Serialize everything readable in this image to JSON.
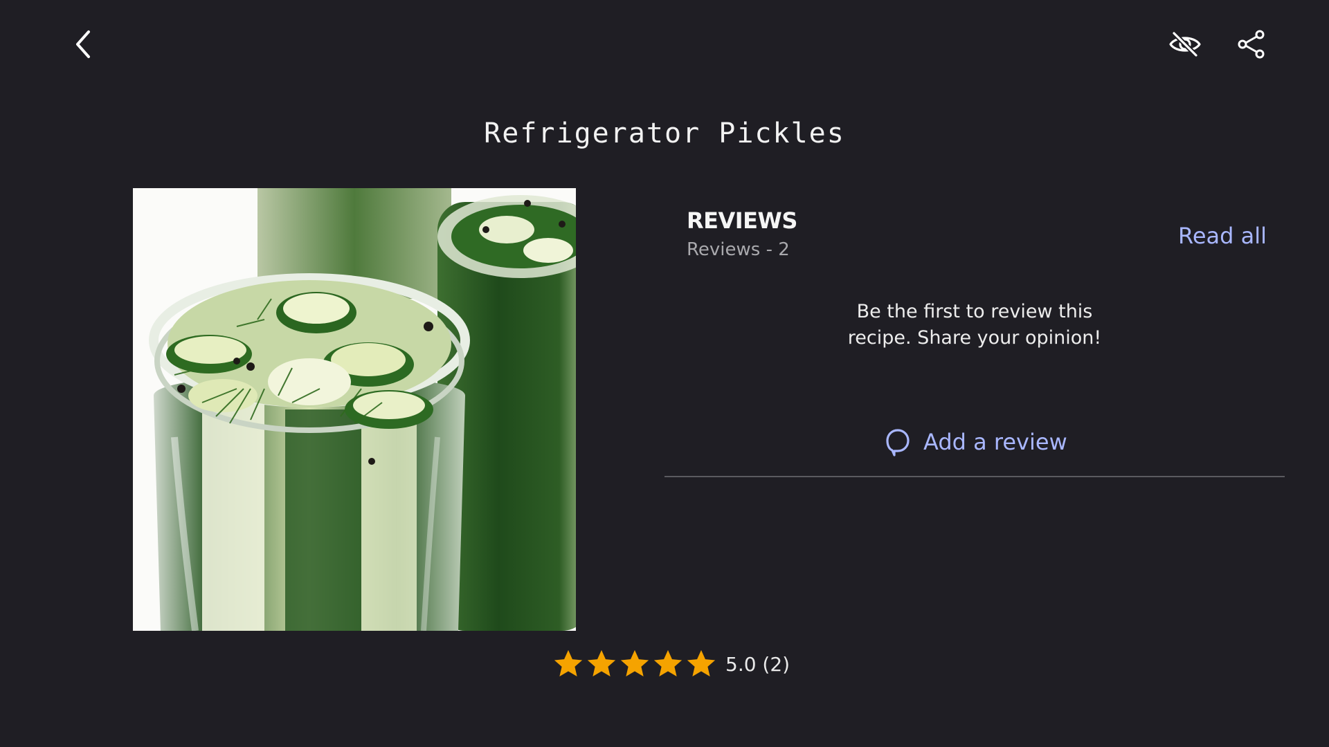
{
  "recipe": {
    "title": "Refrigerator Pickles",
    "image_alt": "Refrigerator pickles in glass jars"
  },
  "toolbar": {
    "back_icon": "chevron-left-icon",
    "hide_icon": "eye-off-icon",
    "share_icon": "share-icon"
  },
  "rating": {
    "stars": 5,
    "text": "5.0 (2)",
    "star_color": "#f5a300"
  },
  "reviews": {
    "heading": "REVIEWS",
    "count_label": "Reviews - 2",
    "read_all_label": "Read all",
    "empty_message": "Be the first to review this recipe. Share your opinion!",
    "add_review_label": "Add a review",
    "accent_color": "#a9b7ff"
  }
}
